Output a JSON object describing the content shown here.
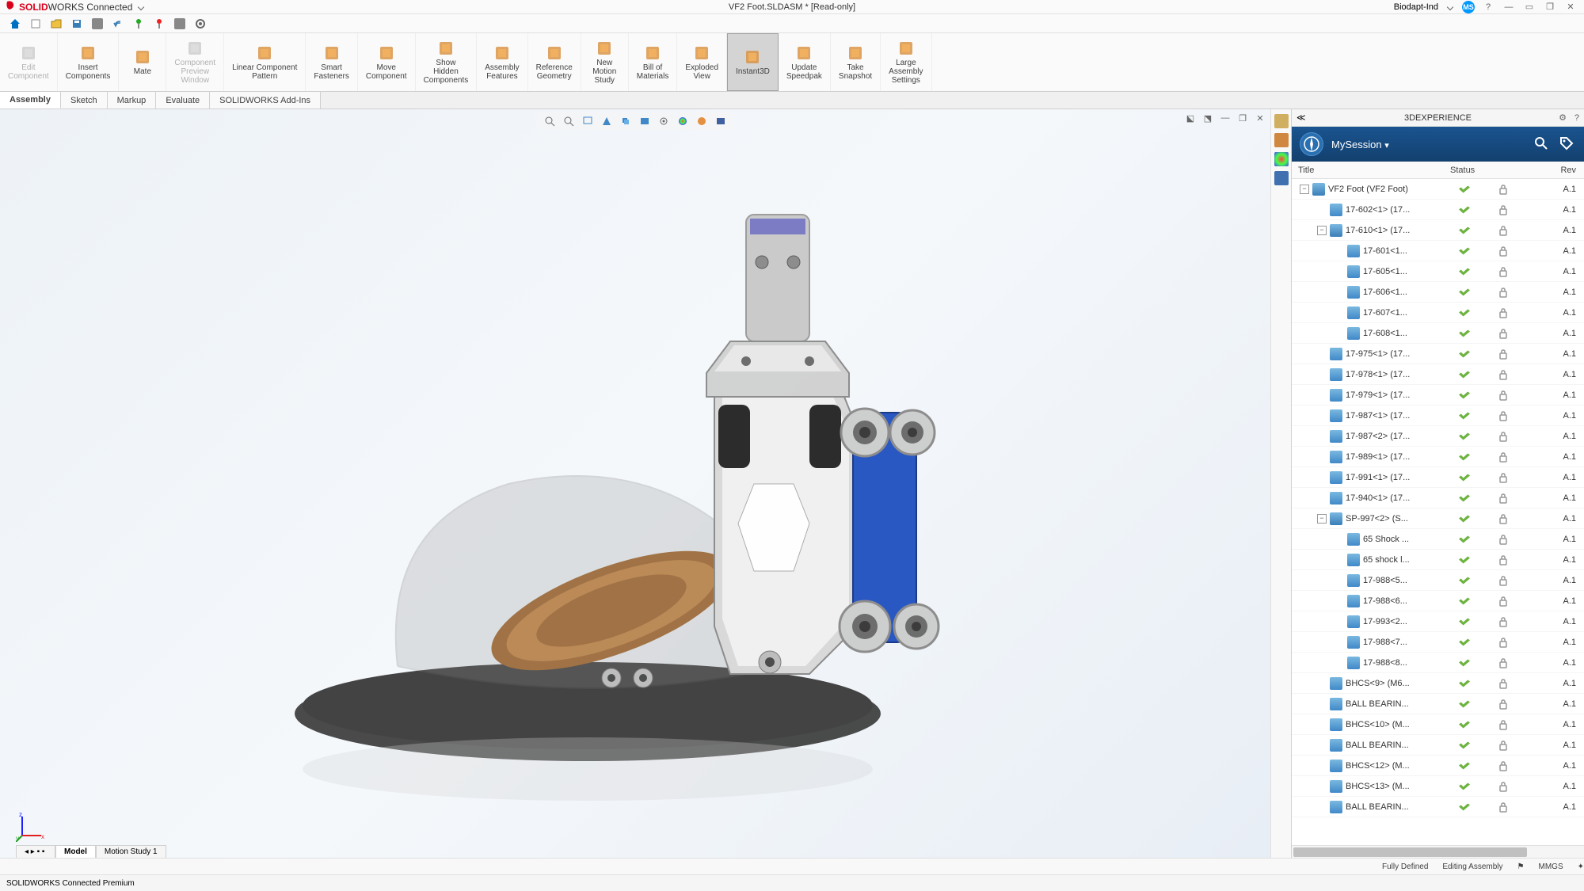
{
  "brand": {
    "prefix": "SOLID",
    "mid": "WORKS",
    "suffix": " Connected"
  },
  "title": "VF2 Foot.SLDASM * [Read-only]",
  "user": {
    "name": "Biodapt-Ind",
    "initials": "MS"
  },
  "ribbon": [
    {
      "label": "Edit\nComponent",
      "disabled": true
    },
    {
      "label": "Insert\nComponents"
    },
    {
      "label": "Mate"
    },
    {
      "label": "Component\nPreview\nWindow",
      "disabled": true
    },
    {
      "label": "Linear Component\nPattern"
    },
    {
      "label": "Smart\nFasteners"
    },
    {
      "label": "Move\nComponent"
    },
    {
      "label": "Show\nHidden\nComponents"
    },
    {
      "label": "Assembly\nFeatures"
    },
    {
      "label": "Reference\nGeometry"
    },
    {
      "label": "New\nMotion\nStudy"
    },
    {
      "label": "Bill of\nMaterials"
    },
    {
      "label": "Exploded\nView"
    },
    {
      "label": "Instant3D",
      "active": true
    },
    {
      "label": "Update\nSpeedpak"
    },
    {
      "label": "Take\nSnapshot"
    },
    {
      "label": "Large\nAssembly\nSettings"
    }
  ],
  "tabs": [
    {
      "label": "Assembly",
      "active": true
    },
    {
      "label": "Sketch"
    },
    {
      "label": "Markup"
    },
    {
      "label": "Evaluate"
    },
    {
      "label": "SOLIDWORKS Add-Ins"
    }
  ],
  "bottomTabs": [
    {
      "label": "Model",
      "active": true
    },
    {
      "label": "Motion Study 1"
    }
  ],
  "panel": {
    "title": "3DEXPERIENCE",
    "session": "MySession",
    "headers": {
      "title": "Title",
      "status": "Status",
      "rev": "Rev"
    }
  },
  "tree": [
    {
      "indent": 0,
      "exp": "-",
      "type": "asm",
      "label": "VF2 Foot (VF2 Foot)",
      "rev": "A.1"
    },
    {
      "indent": 1,
      "exp": "",
      "type": "part",
      "label": "17-602<1> (17...",
      "rev": "A.1"
    },
    {
      "indent": 1,
      "exp": "-",
      "type": "asm",
      "label": "17-610<1> (17...",
      "rev": "A.1"
    },
    {
      "indent": 2,
      "exp": "",
      "type": "part",
      "label": "17-601<1...",
      "rev": "A.1"
    },
    {
      "indent": 2,
      "exp": "",
      "type": "part",
      "label": "17-605<1...",
      "rev": "A.1"
    },
    {
      "indent": 2,
      "exp": "",
      "type": "part",
      "label": "17-606<1...",
      "rev": "A.1"
    },
    {
      "indent": 2,
      "exp": "",
      "type": "part",
      "label": "17-607<1...",
      "rev": "A.1"
    },
    {
      "indent": 2,
      "exp": "",
      "type": "part",
      "label": "17-608<1...",
      "rev": "A.1"
    },
    {
      "indent": 1,
      "exp": "",
      "type": "part",
      "label": "17-975<1> (17...",
      "rev": "A.1"
    },
    {
      "indent": 1,
      "exp": "",
      "type": "part",
      "label": "17-978<1> (17...",
      "rev": "A.1"
    },
    {
      "indent": 1,
      "exp": "",
      "type": "part",
      "label": "17-979<1> (17...",
      "rev": "A.1"
    },
    {
      "indent": 1,
      "exp": "",
      "type": "part",
      "label": "17-987<1> (17...",
      "rev": "A.1"
    },
    {
      "indent": 1,
      "exp": "",
      "type": "part",
      "label": "17-987<2> (17...",
      "rev": "A.1"
    },
    {
      "indent": 1,
      "exp": "",
      "type": "part",
      "label": "17-989<1> (17...",
      "rev": "A.1"
    },
    {
      "indent": 1,
      "exp": "",
      "type": "part",
      "label": "17-991<1> (17...",
      "rev": "A.1"
    },
    {
      "indent": 1,
      "exp": "",
      "type": "part",
      "label": "17-940<1> (17...",
      "rev": "A.1"
    },
    {
      "indent": 1,
      "exp": "-",
      "type": "asm",
      "label": "SP-997<2> (S...",
      "rev": "A.1"
    },
    {
      "indent": 2,
      "exp": "",
      "type": "part",
      "label": "65 Shock ...",
      "rev": "A.1"
    },
    {
      "indent": 2,
      "exp": "",
      "type": "part",
      "label": "65 shock l...",
      "rev": "A.1"
    },
    {
      "indent": 2,
      "exp": "",
      "type": "part",
      "label": "17-988<5...",
      "rev": "A.1"
    },
    {
      "indent": 2,
      "exp": "",
      "type": "part",
      "label": "17-988<6...",
      "rev": "A.1"
    },
    {
      "indent": 2,
      "exp": "",
      "type": "part",
      "label": "17-993<2...",
      "rev": "A.1"
    },
    {
      "indent": 2,
      "exp": "",
      "type": "part",
      "label": "17-988<7...",
      "rev": "A.1"
    },
    {
      "indent": 2,
      "exp": "",
      "type": "part",
      "label": "17-988<8...",
      "rev": "A.1"
    },
    {
      "indent": 1,
      "exp": "",
      "type": "part",
      "label": "BHCS<9> (M6...",
      "rev": "A.1"
    },
    {
      "indent": 1,
      "exp": "",
      "type": "part",
      "label": "BALL BEARIN...",
      "rev": "A.1"
    },
    {
      "indent": 1,
      "exp": "",
      "type": "part",
      "label": "BHCS<10> (M...",
      "rev": "A.1"
    },
    {
      "indent": 1,
      "exp": "",
      "type": "part",
      "label": "BALL BEARIN...",
      "rev": "A.1"
    },
    {
      "indent": 1,
      "exp": "",
      "type": "part",
      "label": "BHCS<12> (M...",
      "rev": "A.1"
    },
    {
      "indent": 1,
      "exp": "",
      "type": "part",
      "label": "BHCS<13> (M...",
      "rev": "A.1"
    },
    {
      "indent": 1,
      "exp": "",
      "type": "part",
      "label": "BALL BEARIN...",
      "rev": "A.1"
    }
  ],
  "status": {
    "product": "SOLIDWORKS Connected Premium",
    "defined": "Fully Defined",
    "mode": "Editing Assembly",
    "units": "MMGS"
  }
}
